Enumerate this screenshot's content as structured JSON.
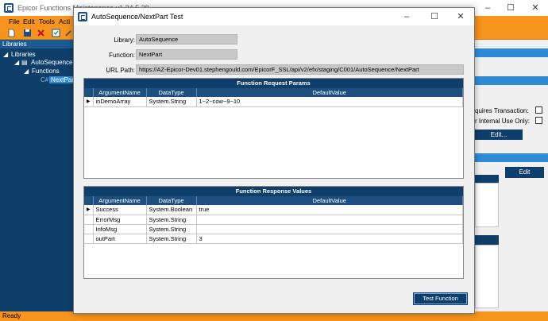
{
  "background_app": {
    "title": "Epicor Functions Maintenance v1.24.5.28",
    "menu": [
      "File",
      "Edit",
      "Tools",
      "Acti"
    ],
    "sidebar": {
      "header": "Libraries",
      "tree": [
        "Libraries",
        "AutoSequence",
        "Functions",
        "NextPart"
      ],
      "code_prefix": "C#"
    },
    "right_panel": {
      "requires_transaction": "quires Transaction:",
      "internal_use_only": "r Internal Use Only:",
      "edit_dots_label": "Edit...",
      "edit_label": "Edit"
    },
    "status": "Ready"
  },
  "dialog": {
    "title": "AutoSequence/NextPart Test",
    "library_label": "Library:",
    "library_value": "AutoSequence",
    "function_label": "Function:",
    "function_value": "NextPart",
    "url_label": "URL Path:",
    "url_value": "https://AZ-Epicor-Dev01.stephengould.com/EpicorF_SSL/api/v2/efx/staging/C001/AutoSequence/NextPart",
    "request_panel": {
      "title": "Function Request Params",
      "columns": [
        "ArgumentName",
        "DataType",
        "DefaultValue"
      ],
      "rows": [
        {
          "name": "inDemoArray",
          "type": "System.String",
          "value": "1~2~cow~9~10"
        }
      ]
    },
    "response_panel": {
      "title": "Function Response Values",
      "columns": [
        "ArgumentName",
        "DataType",
        "DefaultValue"
      ],
      "rows": [
        {
          "name": "Success",
          "type": "System.Boolean",
          "value": "true"
        },
        {
          "name": "ErrorMsg",
          "type": "System.String",
          "value": ""
        },
        {
          "name": "InfoMsg",
          "type": "System.String",
          "value": ""
        },
        {
          "name": "outPart",
          "type": "System.String",
          "value": "3"
        }
      ]
    },
    "test_button": "Test Function"
  },
  "colors": {
    "accent_orange": "#f7941d",
    "navy": "#0e3f6b",
    "header_blue": "#1d4f80",
    "selection_blue": "#2e8bd6"
  },
  "icons": [
    "app-icon",
    "new-document-icon",
    "save-icon",
    "delete-icon",
    "checklist-icon",
    "pencil-icon",
    "minimize-icon",
    "maximize-icon",
    "close-icon",
    "row-selector-arrow-icon",
    "folder-icon"
  ]
}
